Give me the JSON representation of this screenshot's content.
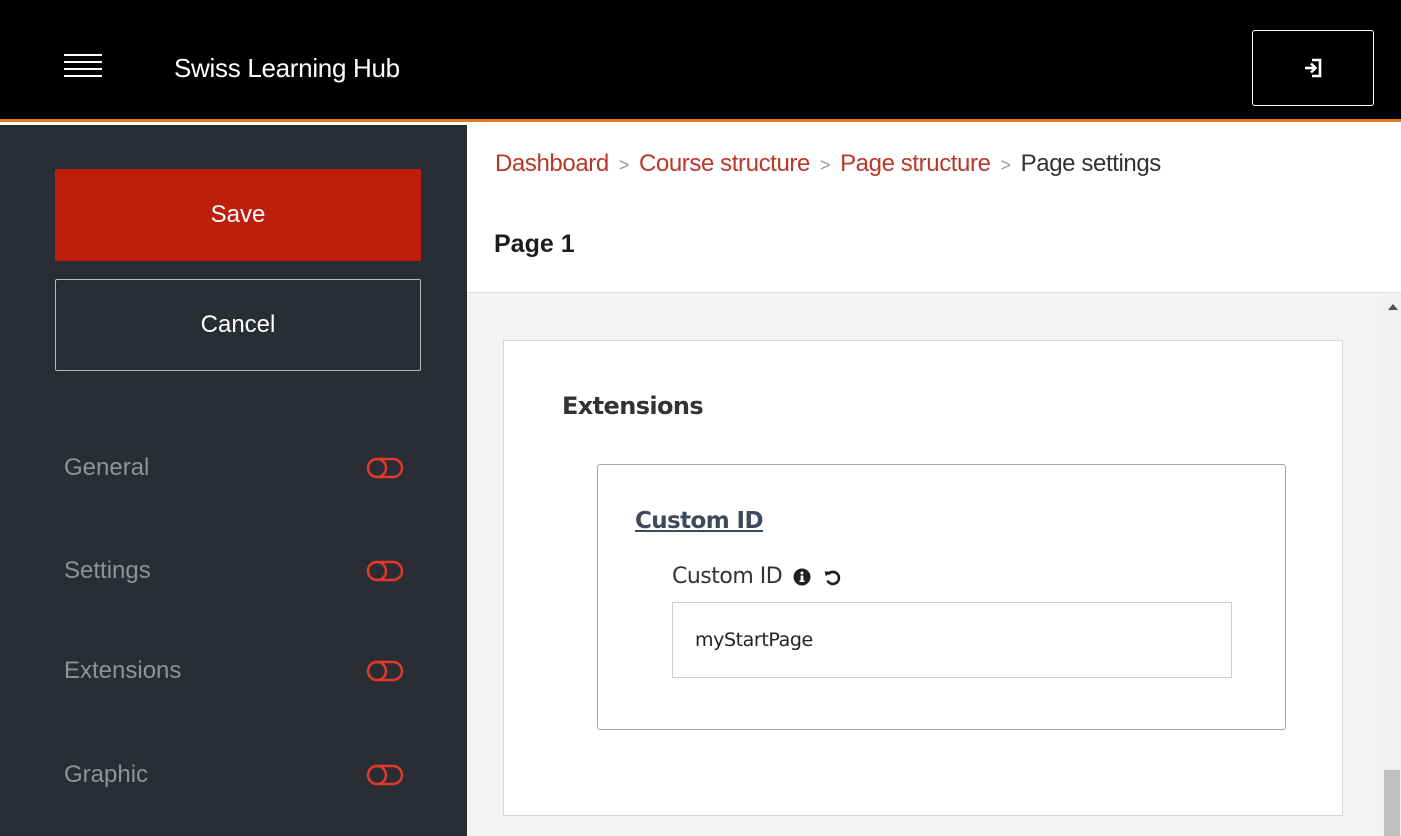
{
  "app": {
    "title": "Swiss Learning Hub",
    "menu_icon": "hamburger-menu-icon",
    "logout_icon": "sign-out-icon",
    "accent_color": "#e07b1a"
  },
  "sidebar": {
    "save_label": "Save",
    "cancel_label": "Cancel",
    "save_color": "#be1e0c",
    "items": [
      {
        "label": "General",
        "icon": "toggle-icon"
      },
      {
        "label": "Settings",
        "icon": "toggle-icon"
      },
      {
        "label": "Extensions",
        "icon": "toggle-icon"
      },
      {
        "label": "Graphic",
        "icon": "toggle-icon"
      }
    ]
  },
  "breadcrumb": {
    "items": [
      "Dashboard",
      "Course structure",
      "Page structure"
    ],
    "current": "Page settings",
    "separator": ">",
    "link_color": "#b8382a"
  },
  "page": {
    "title": "Page 1"
  },
  "extensions": {
    "title": "Extensions",
    "section_title": "Custom ID",
    "field": {
      "label": "Custom ID",
      "value": "myStartPage",
      "info_icon": "info-icon",
      "reset_icon": "undo-icon"
    }
  }
}
